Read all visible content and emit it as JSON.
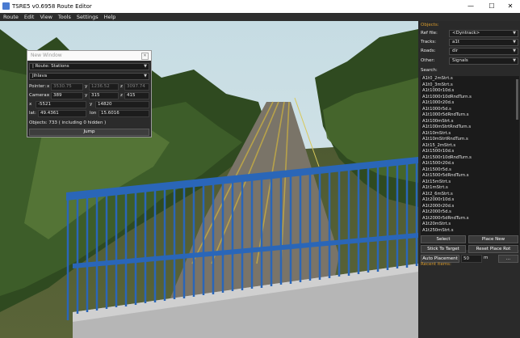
{
  "window": {
    "title": "TSRE5 v0.6958 Route Editor",
    "minimize": "—",
    "maximize": "☐",
    "close": "✕"
  },
  "menu": [
    "Route",
    "Edit",
    "View",
    "Tools",
    "Settings",
    "Help"
  ],
  "new_window": {
    "title": "New Window",
    "route_combo": "| Route: Stations",
    "place_combo": "Jihlava",
    "pointer_label": "Pointer:",
    "pointer_x": "3530.75",
    "pointer_y": "1236.52",
    "pointer_z": "3097.74",
    "camera_label": "Camera:",
    "camera_x": "389",
    "camera_y": "315",
    "camera_z": "415",
    "x_val": "-5521",
    "y_val": "14820",
    "lat": "49.4361",
    "lon": "15.6016",
    "objects_text": "Objects: 733 ( including 0 hidden )",
    "jump_label": "Jump",
    "axis": {
      "x": "x",
      "y": "y",
      "z": "z",
      "lat": "lat:",
      "lon": "lon"
    }
  },
  "right_panel": {
    "objects_header": "Objects:",
    "ref_file_label": "Ref file:",
    "ref_file_value": "<Dyntrack>",
    "tracks_label": "Tracks:",
    "tracks_value": "a1t",
    "roads_label": "Roads:",
    "roads_value": "dir",
    "other_label": "Other:",
    "other_value": "Signals",
    "search_label": "Search:",
    "items": [
      "A1t0_2mStrt.s",
      "A1t0_3mStrt.s",
      "A1t1000r10d.s",
      "A1t1000r10dRndTurn.s",
      "A1t1000r20d.s",
      "A1t1000r5d.s",
      "A1t1000r5dRndTurn.s",
      "A1t100mStrt.s",
      "A1t100mStrtRndTurn.s",
      "A1t10mStrt.s",
      "A1t10mStrtRndTurn.s",
      "A1t15_2mStrt.s",
      "A1t1500r10d.s",
      "A1t1500r10dRndTurn.s",
      "A1t1500r20d.s",
      "A1t1500r5d.s",
      "A1t1500r5dRndTurn.s",
      "A1t15mStrt.s",
      "A1t1mStrt.s",
      "A1t2_6mStrt.s",
      "A1t2000r10d.s",
      "A1t2000r20d.s",
      "A1t2000r5d.s",
      "A1t2000r5dRndTurn.s",
      "A1t20mStrt.s",
      "A1t250mStrt.s"
    ],
    "select_label": "Select",
    "place_new_label": "Place New",
    "stick_label": "Stick To Target",
    "reset_rot_label": "Reset Place Rot",
    "auto_label": "Auto Placement",
    "auto_value": "50",
    "auto_unit": "m",
    "more_label": "...",
    "recent_label": "Recent items:"
  }
}
